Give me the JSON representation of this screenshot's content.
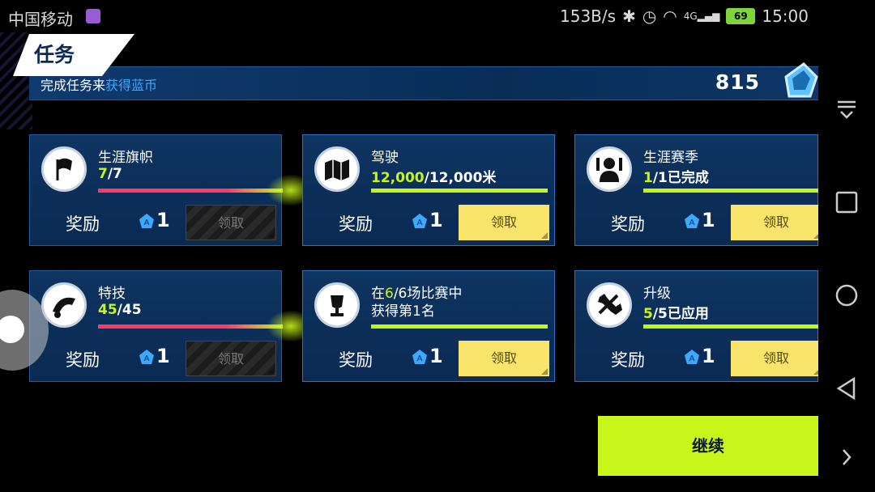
{
  "status": {
    "carrier": "中国移动",
    "speed": "153B/s",
    "signal": "4G",
    "battery": "69",
    "time": "15:00"
  },
  "header": {
    "title": "任务",
    "banner_prefix": "完成任务来",
    "banner_highlight": "获得蓝币",
    "coins": "815"
  },
  "reward_label": "奖励",
  "claim_label": "领取",
  "cards": [
    {
      "title": "生涯旗帜",
      "title2": "",
      "progress_current": "7",
      "progress_total": "/7",
      "reward": "1",
      "bar_fill": 1.0,
      "claimable": false,
      "icon": "flag-icon"
    },
    {
      "title": "驾驶",
      "title2": "",
      "progress_current": "12,000",
      "progress_total": "/12,000米",
      "reward": "1",
      "bar_fill": 1.0,
      "claimable": true,
      "icon": "map-icon"
    },
    {
      "title": "生涯赛季",
      "title2": "",
      "progress_current": "1",
      "progress_total": "/1已完成",
      "reward": "1",
      "bar_fill": 1.0,
      "claimable": true,
      "icon": "racer-icon"
    },
    {
      "title": "特技",
      "title2": "",
      "progress_current": "45",
      "progress_total": "/45",
      "reward": "1",
      "bar_fill": 1.0,
      "claimable": false,
      "icon": "stunt-icon"
    },
    {
      "title": "在",
      "title_cur": "6",
      "title_tail": "/6场比赛中",
      "title2": "获得第1名",
      "progress_current": "",
      "progress_total": "",
      "reward": "1",
      "bar_fill": 1.0,
      "claimable": true,
      "icon": "trophy-icon"
    },
    {
      "title": "升级",
      "title2": "",
      "progress_current": "5",
      "progress_total": "/5已应用",
      "reward": "1",
      "bar_fill": 1.0,
      "claimable": true,
      "icon": "wrench-icon"
    }
  ],
  "continue_label": "继续",
  "colors": {
    "accent": "#c8f51a",
    "claim_active": "#f8e36b",
    "progress_red": "#ff3a6b",
    "highlight": "#3aa9ff"
  }
}
